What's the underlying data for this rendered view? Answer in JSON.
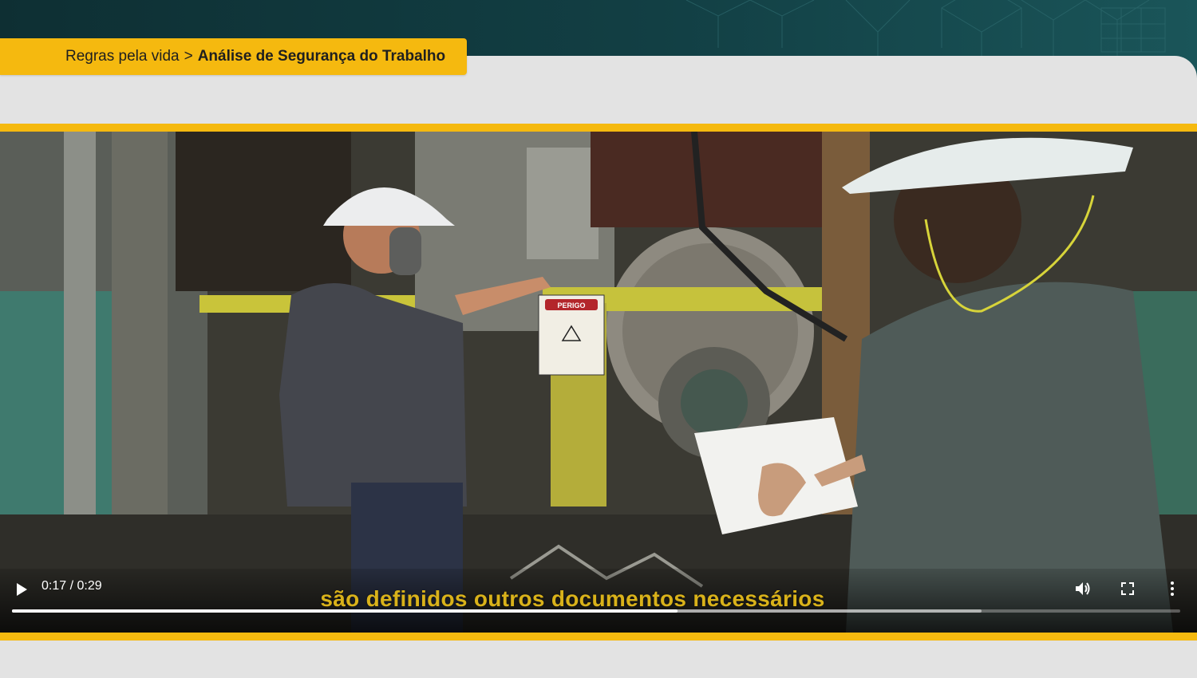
{
  "breadcrumb": {
    "parent": "Regras pela vida",
    "separator": ">",
    "current": "Análise de Segurança do Trabalho"
  },
  "video": {
    "subtitle": "são definidos outros documentos necessários",
    "time": "0:17 / 0:29",
    "played_fraction": 0.57,
    "buffered_fraction": 0.83,
    "sign_title": "PERIGO"
  },
  "icons": {
    "play": "play-icon",
    "volume": "volume-icon",
    "fullscreen": "fullscreen-icon",
    "more": "more-vert-icon"
  },
  "colors": {
    "accent": "#f5b90f",
    "header": "#123f44",
    "panel": "#e3e3e3"
  }
}
